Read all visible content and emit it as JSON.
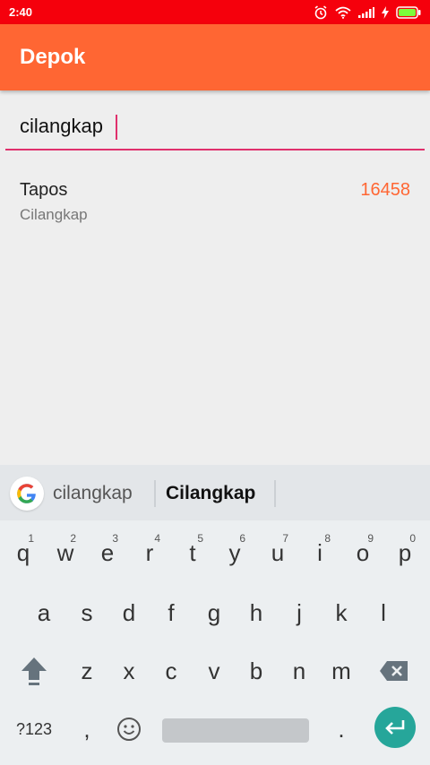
{
  "status_bar": {
    "time": "2:40"
  },
  "app_bar": {
    "title": "Depok"
  },
  "search": {
    "value": "cilangkap"
  },
  "results": [
    {
      "title": "Tapos",
      "subtitle": "Cilangkap",
      "code": "16458"
    }
  ],
  "keyboard": {
    "suggestions": [
      "cilangkap",
      "Cilangkap"
    ],
    "row1": [
      {
        "key": "q",
        "hint": "1"
      },
      {
        "key": "w",
        "hint": "2"
      },
      {
        "key": "e",
        "hint": "3"
      },
      {
        "key": "r",
        "hint": "4"
      },
      {
        "key": "t",
        "hint": "5"
      },
      {
        "key": "y",
        "hint": "6"
      },
      {
        "key": "u",
        "hint": "7"
      },
      {
        "key": "i",
        "hint": "8"
      },
      {
        "key": "o",
        "hint": "9"
      },
      {
        "key": "p",
        "hint": "0"
      }
    ],
    "row2": [
      "a",
      "s",
      "d",
      "f",
      "g",
      "h",
      "j",
      "k",
      "l"
    ],
    "row3": [
      "z",
      "x",
      "c",
      "v",
      "b",
      "n",
      "m"
    ],
    "symbols_label": "?123",
    "comma": ",",
    "period": "."
  },
  "colors": {
    "status_bar": "#f5000c",
    "app_bar": "#ff6633",
    "accent": "#e0306c",
    "enter": "#26a69a"
  }
}
